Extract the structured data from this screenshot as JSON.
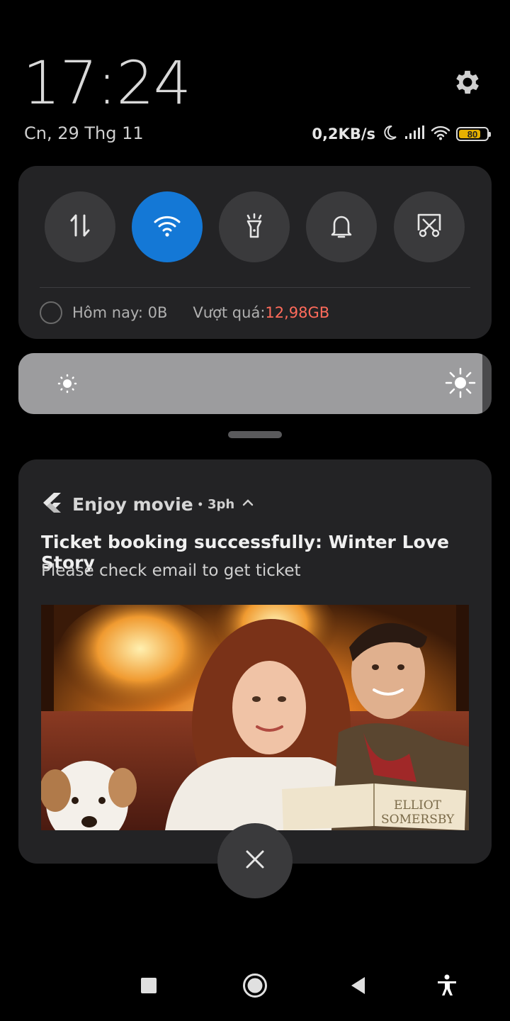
{
  "status": {
    "time": "17:24",
    "date": "Cn, 29 Thg 11",
    "net_speed": "0,2KB/s",
    "battery_level": 80,
    "battery_text": "80"
  },
  "quick_settings": {
    "tiles": [
      {
        "name": "mobile-data",
        "icon": "data-transfer-icon",
        "active": false
      },
      {
        "name": "wifi",
        "icon": "wifi-icon",
        "active": true
      },
      {
        "name": "flashlight",
        "icon": "flashlight-icon",
        "active": false
      },
      {
        "name": "sound",
        "icon": "bell-icon",
        "active": false
      },
      {
        "name": "screenshot",
        "icon": "screenshot-icon",
        "active": false
      }
    ],
    "usage_today_label": "Hôm nay: 0B",
    "overage_label": "Vượt quá: ",
    "overage_value": "12,98GB"
  },
  "brightness": {
    "level": 0.98
  },
  "notification": {
    "app_name": "Enjoy movie",
    "separator": "•",
    "time_ago": "3ph",
    "title": "Ticket booking successfully: Winter Love Story",
    "body": "Please check email to get ticket",
    "poster_text_line1": "ELLIOT",
    "poster_text_line2": "SOMERSBY"
  },
  "colors": {
    "accent": "#1478d6",
    "panel": "#232325",
    "overage": "#ff6b5b",
    "battery": "#e6b000"
  }
}
